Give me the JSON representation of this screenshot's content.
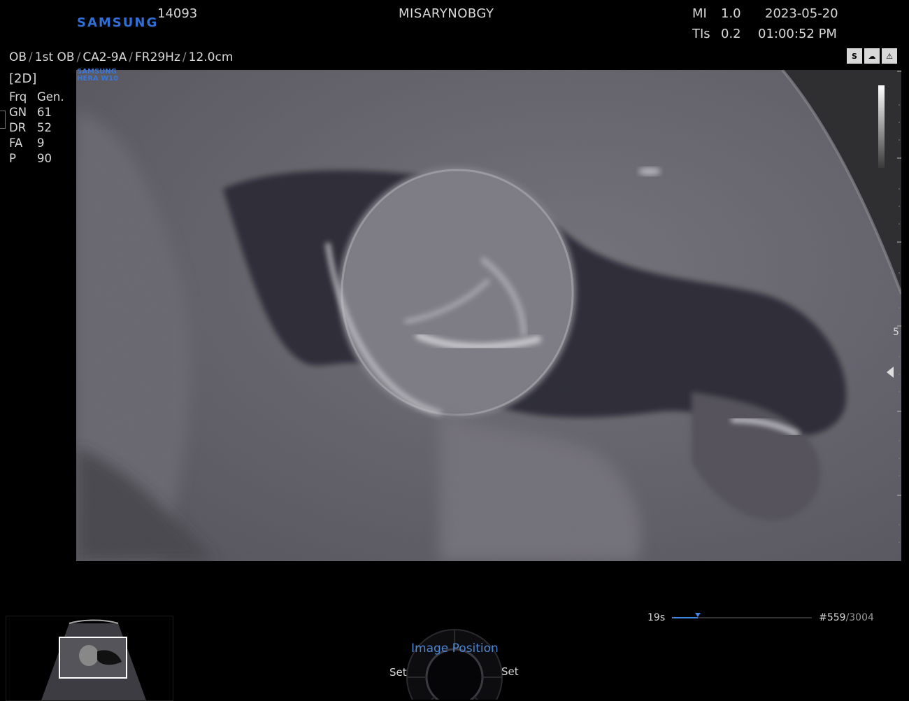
{
  "header": {
    "brand": "SAMSUNG",
    "patient_id": "14093",
    "institution": "MISARYNOBGY",
    "mi_label": "MI",
    "mi_value": "1.0",
    "tis_label": "TIs",
    "tis_value": "0.2",
    "date": "2023-05-20",
    "time": "01:00:52 PM"
  },
  "preset": {
    "application": "OB",
    "exam": "1st OB",
    "probe": "CA2-9A",
    "frame_rate": "FR29Hz",
    "depth": "12.0cm"
  },
  "mode": "[2D]",
  "params": [
    {
      "key": "Frq",
      "value": "Gen."
    },
    {
      "key": "GN",
      "value": "61"
    },
    {
      "key": "DR",
      "value": "52"
    },
    {
      "key": "FA",
      "value": "9"
    },
    {
      "key": "P",
      "value": "90"
    }
  ],
  "scan_logo": {
    "line1": "SAMSUNG",
    "line2": "HERA W10"
  },
  "top_icons": [
    {
      "name": "s-har-icon",
      "glyph": "S"
    },
    {
      "name": "fetus-icon",
      "glyph": "☁"
    },
    {
      "name": "warning-icon",
      "glyph": "⚠"
    }
  ],
  "depth_marker": "5",
  "cine": {
    "time": "19s",
    "frame": "#559",
    "total": "/3004",
    "progress": 0.186
  },
  "knob": {
    "title": "Image Position",
    "left": "Set",
    "right": "Set"
  },
  "colors": {
    "accent": "#3f86e0",
    "brand": "#2f6fd6"
  }
}
